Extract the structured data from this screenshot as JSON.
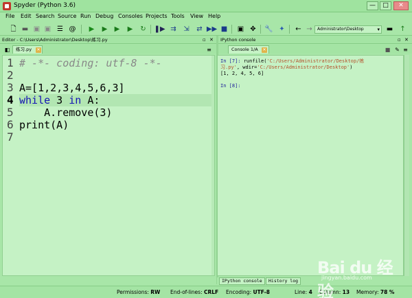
{
  "window": {
    "title": "Spyder (Python 3.6)",
    "minimize": "—",
    "maximize": "□",
    "close": "✕"
  },
  "menu": [
    "File",
    "Edit",
    "Search",
    "Source",
    "Run",
    "Debug",
    "Consoles",
    "Projects",
    "Tools",
    "View",
    "Help"
  ],
  "toolbar": {
    "path_value": "Administrator\\Desktop",
    "icons": [
      "new-file-icon",
      "open-file-icon",
      "save-icon",
      "save-all-icon",
      "list-icon",
      "at-icon",
      "run-icon",
      "run-cell-icon",
      "run-cell-advance-icon",
      "run-selection-icon",
      "rerun-icon",
      "debug-icon",
      "step-icon",
      "step-into-icon",
      "step-return-icon",
      "continue-icon",
      "stop-icon",
      "maximize-pane-icon",
      "fullscreen-icon",
      "wrench-icon",
      "python-path-icon",
      "back-icon",
      "forward-icon",
      "browse-folder-icon",
      "parent-folder-icon"
    ]
  },
  "editor": {
    "header": "Editor - C:\\Users\\Administrator\\Desktop\\练习.py",
    "tab_label": "练习.py",
    "current_line": 4,
    "lines": [
      {
        "num": "1",
        "text": "# -*- coding: utf-8 -*-"
      },
      {
        "num": "2",
        "text": ""
      },
      {
        "num": "3",
        "text": "A=[1,2,3,4,5,6,3]"
      },
      {
        "num": "4",
        "kw": "while",
        "mid": " 3 ",
        "kw2": "in",
        "rest": " A:"
      },
      {
        "num": "5",
        "text": "    A.remove(3)"
      },
      {
        "num": "6",
        "text": "print(A)"
      },
      {
        "num": "7",
        "text": ""
      }
    ]
  },
  "console": {
    "header": "IPython console",
    "tab_label": "Console 1/A",
    "prompt1": "In [7]: ",
    "cmd1": "runfile(",
    "str1": "'C:/Users/Administrator/Desktop/练",
    "str1b": "习.py'",
    "mid1": ", wdir=",
    "str2": "'C:/Users/Administrator/Desktop'",
    "end1": ")",
    "output": "[1, 2, 4, 5, 6]",
    "prompt2": "In [8]:",
    "bottom_tabs": [
      "IPython console",
      "History log"
    ]
  },
  "status": {
    "permissions_label": "Permissions:",
    "permissions": "RW",
    "eol_label": "End-of-lines:",
    "eol": "CRLF",
    "encoding_label": "Encoding:",
    "encoding": "UTF-8",
    "line_label": "Line:",
    "line": "4",
    "column_label": "Column:",
    "column": "13",
    "memory_label": "Memory:",
    "memory": "78 %"
  },
  "watermark": {
    "text": "Bai du 经验",
    "sub": "jingyan.baidu.com"
  }
}
